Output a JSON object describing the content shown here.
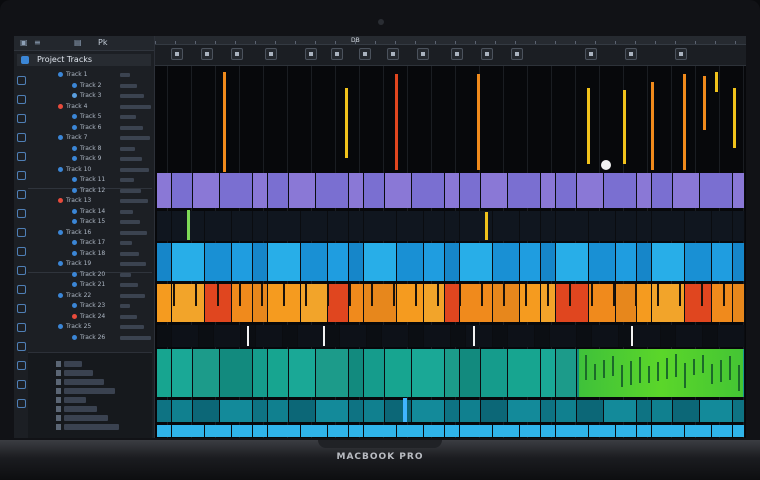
{
  "window": {
    "brand": "MACBOOK PRO"
  },
  "toolbar": {
    "title": "DB",
    "buttons": [
      {
        "name": "rewind-button"
      },
      {
        "name": "forward-button"
      },
      {
        "name": "stop-button"
      },
      {
        "name": "play-button"
      },
      {
        "name": "record-button"
      },
      {
        "name": "cycle-button"
      },
      {
        "name": "metronome-button"
      },
      {
        "name": "tuner-button"
      },
      {
        "name": "mixer-button"
      },
      {
        "name": "editor-button"
      },
      {
        "name": "library-button"
      },
      {
        "name": "smart-controls-button"
      },
      {
        "name": "loops-button"
      },
      {
        "name": "media-button"
      },
      {
        "name": "notes-button"
      }
    ]
  },
  "left_panel": {
    "header_top": "Pk",
    "header": "Project Tracks",
    "rows": [
      {
        "label": "Track 1",
        "color": "#3b86d6"
      },
      {
        "label": "Track 2",
        "color": "#3b86d6"
      },
      {
        "label": "Track 3",
        "color": "#5a9fe0"
      },
      {
        "label": "Track 4",
        "color": "#e84b3c"
      },
      {
        "label": "Track 5",
        "color": "#3b86d6"
      },
      {
        "label": "Track 6",
        "color": "#3b86d6"
      },
      {
        "label": "Track 7",
        "color": "#3b86d6"
      },
      {
        "label": "Track 8",
        "color": "#3b86d6"
      },
      {
        "label": "Track 9",
        "color": "#3b86d6"
      },
      {
        "label": "Track 10",
        "color": "#3b86d6"
      },
      {
        "label": "Track 11",
        "color": "#3b86d6"
      },
      {
        "label": "Track 12",
        "color": "#3b86d6"
      },
      {
        "label": "Track 13",
        "color": "#e84b3c"
      },
      {
        "label": "Track 14",
        "color": "#3b86d6"
      },
      {
        "label": "Track 15",
        "color": "#3b86d6"
      },
      {
        "label": "Track 16",
        "color": "#3b86d6"
      },
      {
        "label": "Track 17",
        "color": "#3b86d6"
      },
      {
        "label": "Track 18",
        "color": "#3b86d6"
      },
      {
        "label": "Track 19",
        "color": "#3b86d6"
      },
      {
        "label": "Track 20",
        "color": "#3b86d6"
      },
      {
        "label": "Track 21",
        "color": "#3b86d6"
      },
      {
        "label": "Track 22",
        "color": "#3b86d6"
      },
      {
        "label": "Track 23",
        "color": "#3b86d6"
      },
      {
        "label": "Track 24",
        "color": "#e84b3c"
      },
      {
        "label": "Track 25",
        "color": "#3b86d6"
      },
      {
        "label": "Track 26",
        "color": "#3b86d6"
      }
    ]
  },
  "colors": {
    "orange": "#f08a1c",
    "red": "#e0461f",
    "yellow": "#f1c21b",
    "blue": "#1e9be0",
    "cyan": "#2ec6e8",
    "purple": "#7a6fd1",
    "teal": "#1c9b8a",
    "green": "#4ccf2a",
    "white": "#f2f2f2"
  }
}
